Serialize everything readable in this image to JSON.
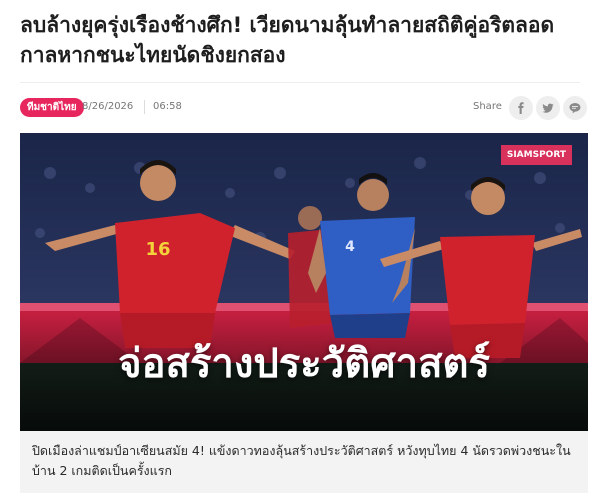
{
  "article": {
    "headline": "ลบล้างยุครุ่งเรืองช้างศึก! เวียดนามลุ้นทำลายสถิติคู่อริตลอดกาลหากชนะไทยนัดชิงยกสอง",
    "category_tag": "ทีมชาติไทย",
    "date": "8/26/2026",
    "time": "06:58",
    "share_label": "Share",
    "share_icons": [
      "facebook-icon",
      "twitter-icon",
      "line-icon"
    ],
    "hero": {
      "watermark": "SIAMSPORT",
      "overlay_text": "จ่อสร้างประวัติศาสตร์",
      "jersey_left_number": "16",
      "jersey_center_number": "4"
    },
    "caption": "ปิดเมืองล่าแชมป์อาเซียนสมัย 4! แข้งดาวทองลุ้นสร้างประวัติศาสตร์ หวังทุบไทย 4 นัดรวดพ่วงชนะในบ้าน 2 เกมติดเป็นครั้งแรก"
  },
  "colors": {
    "accent": "#e8265e",
    "vietnam_red": "#d0222d",
    "thailand_blue": "#2f5fc4",
    "caption_bg": "#f3f3f3"
  }
}
